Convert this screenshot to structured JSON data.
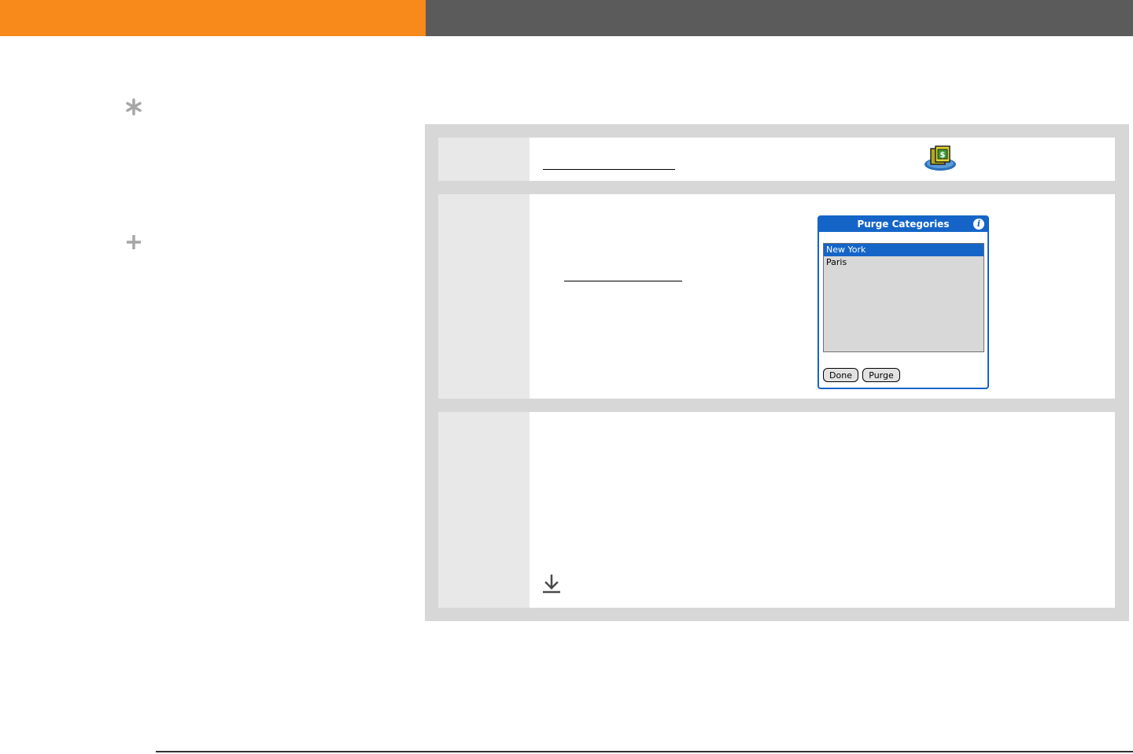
{
  "purge_dialog": {
    "title": "Purge Categories",
    "list_items": [
      "New York",
      "Paris"
    ],
    "selected_item": "New York",
    "done_label": "Done",
    "purge_label": "Purge"
  },
  "icons": {
    "sidebar_tip": "asterisk-icon",
    "sidebar_more": "plus-icon",
    "app": "expense-app-icon",
    "dialog_info": "info-icon",
    "continue": "download-arrow-icon"
  },
  "colors": {
    "header_orange": "#f78a1a",
    "header_gray": "#5b5b5b",
    "dialog_blue": "#1565c8"
  }
}
